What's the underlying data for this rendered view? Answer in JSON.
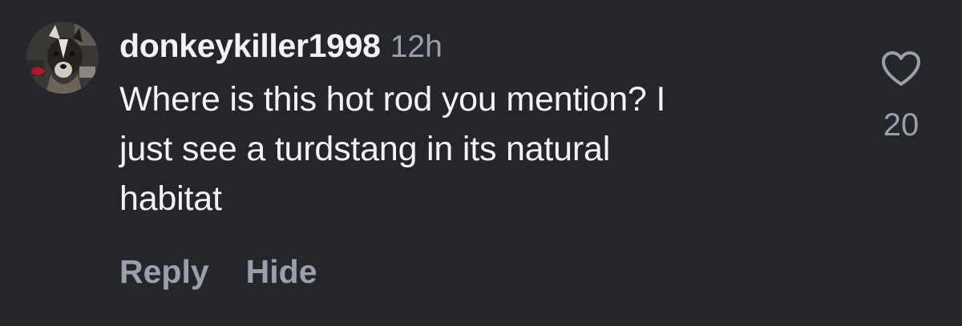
{
  "comment": {
    "author": {
      "username": "donkeykiller1998",
      "avatar_icon": "dog-avatar"
    },
    "timestamp": "12h",
    "text_lines": [
      "Where is this hot rod you mention? I",
      "just see a turdstang in its natural",
      "habitat"
    ],
    "actions": {
      "reply_label": "Reply",
      "hide_label": "Hide"
    },
    "like": {
      "icon": "heart-outline-icon",
      "count": "20"
    }
  },
  "colors": {
    "background": "#24262b",
    "primary_text": "#f2f3f5",
    "secondary_text": "#9aa0a7"
  }
}
